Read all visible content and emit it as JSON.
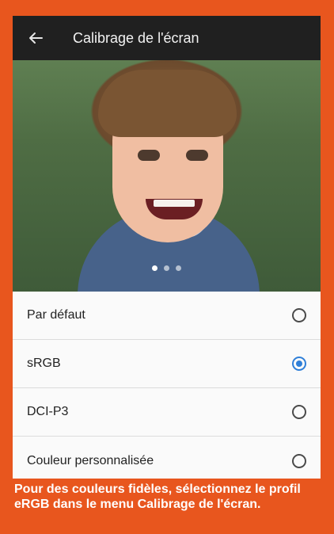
{
  "appbar": {
    "title": "Calibrage de l'écran"
  },
  "carousel": {
    "page_count": 3,
    "active_index": 0
  },
  "options": [
    {
      "label": "Par défaut",
      "selected": false
    },
    {
      "label": "sRGB",
      "selected": true
    },
    {
      "label": "DCI-P3",
      "selected": false
    },
    {
      "label": "Couleur personnalisée",
      "selected": false
    }
  ],
  "caption": {
    "line1": "Pour des couleurs fidèles, sélectionnez le profil",
    "line2": "eRGB dans le menu Calibrage de l'écran."
  },
  "colors": {
    "frame": "#e8561e",
    "appbar": "#202020",
    "accent": "#2f7fd8"
  },
  "icons": {
    "back": "arrow-left-icon"
  }
}
